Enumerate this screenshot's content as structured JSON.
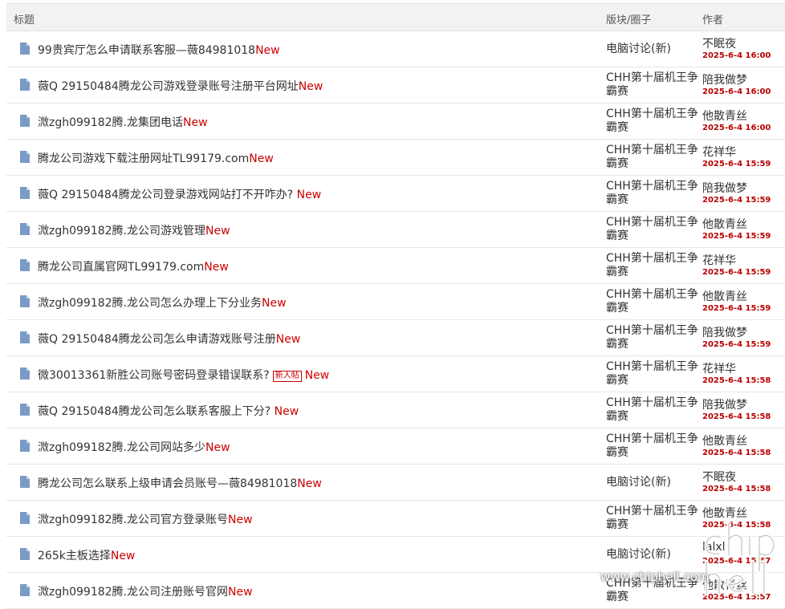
{
  "header": {
    "title": "标题",
    "forum": "版块/圈子",
    "author": "作者"
  },
  "new_label": "New",
  "rows": [
    {
      "title": "99贵宾厅怎么申请联系客服—薇84981018",
      "badge": "",
      "forum": "电脑讨论(新)",
      "author": "不眠夜",
      "date": "2025-6-4 16:00"
    },
    {
      "title": "薇Q 29150484腾龙公司游戏登录账号注册平台网址",
      "badge": "",
      "forum": "CHH第十届机王争霸赛",
      "author": "陪我做梦",
      "date": "2025-6-4 16:00"
    },
    {
      "title": "溦zgh099182腾.龙集团电话",
      "badge": "",
      "forum": "CHH第十届机王争霸赛",
      "author": "他散青丝",
      "date": "2025-6-4 16:00"
    },
    {
      "title": "腾龙公司游戏下载注册网址TL99179.com",
      "badge": "",
      "forum": "CHH第十届机王争霸赛",
      "author": "花祥华",
      "date": "2025-6-4 15:59"
    },
    {
      "title": "薇Q 29150484腾龙公司登录游戏网站打不开咋办? ",
      "badge": "",
      "forum": "CHH第十届机王争霸赛",
      "author": "陪我做梦",
      "date": "2025-6-4 15:59"
    },
    {
      "title": "溦zgh099182腾.龙公司游戏管理",
      "badge": "",
      "forum": "CHH第十届机王争霸赛",
      "author": "他散青丝",
      "date": "2025-6-4 15:59"
    },
    {
      "title": "腾龙公司直属官网TL99179.com",
      "badge": "",
      "forum": "CHH第十届机王争霸赛",
      "author": "花祥华",
      "date": "2025-6-4 15:59"
    },
    {
      "title": "溦zgh099182腾.龙公司怎么办理上下分业务",
      "badge": "",
      "forum": "CHH第十届机王争霸赛",
      "author": "他散青丝",
      "date": "2025-6-4 15:59"
    },
    {
      "title": "薇Q 29150484腾龙公司怎么申请游戏账号注册",
      "badge": "",
      "forum": "CHH第十届机王争霸赛",
      "author": "陪我做梦",
      "date": "2025-6-4 15:59"
    },
    {
      "title": "微30013361新胜公司账号密码登录错误联系?",
      "badge": "新人帖",
      "forum": "CHH第十届机王争霸赛",
      "author": "花祥华",
      "date": "2025-6-4 15:58"
    },
    {
      "title": "薇Q 29150484腾龙公司怎么联系客服上下分? ",
      "badge": "",
      "forum": "CHH第十届机王争霸赛",
      "author": "陪我做梦",
      "date": "2025-6-4 15:58"
    },
    {
      "title": "溦zgh099182腾.龙公司网站多少",
      "badge": "",
      "forum": "CHH第十届机王争霸赛",
      "author": "他散青丝",
      "date": "2025-6-4 15:58"
    },
    {
      "title": "腾龙公司怎么联系上级申请会员账号—薇84981018",
      "badge": "",
      "forum": "电脑讨论(新)",
      "author": "不眠夜",
      "date": "2025-6-4 15:58"
    },
    {
      "title": "溦zgh099182腾.龙公司官方登录账号",
      "badge": "",
      "forum": "CHH第十届机王争霸赛",
      "author": "他散青丝",
      "date": "2025-6-4 15:58"
    },
    {
      "title": "265k主板选择",
      "badge": "",
      "forum": "电脑讨论(新)",
      "author": "lalxl",
      "date": "2025-6-4 15:57"
    },
    {
      "title": "溦zgh099182腾.龙公司注册账号官网",
      "badge": "",
      "forum": "CHH第十届机王争霸赛",
      "author": "他散青丝",
      "date": "2025-6-4 15:57"
    }
  ],
  "watermark": {
    "logo_text": "chip hell",
    "site": "www.chiphell.com"
  },
  "colors": {
    "new": "#cc0000",
    "date": "#b80000",
    "icon": "#7b9bc7",
    "header_bg": "#f2f2f2"
  },
  "icons": {
    "row": "document-icon"
  }
}
